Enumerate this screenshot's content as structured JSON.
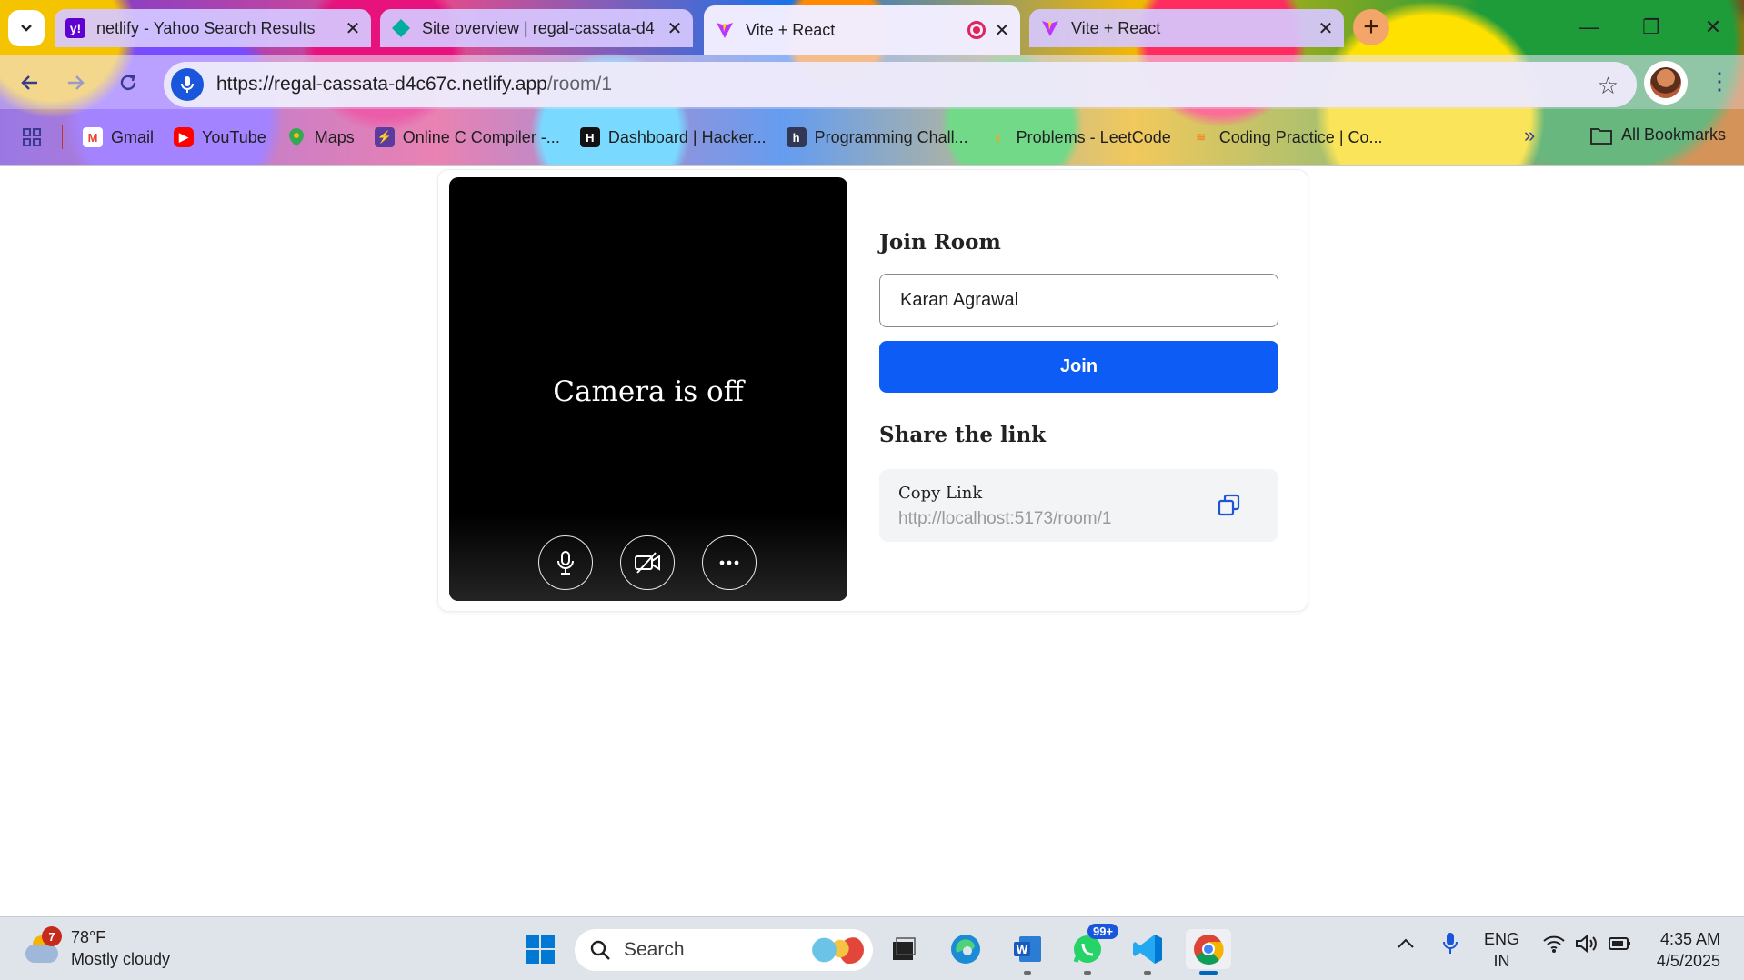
{
  "browser": {
    "tabs": [
      {
        "title": "netlify - Yahoo Search Results",
        "favicon": "yahoo-icon",
        "color": "#6001d2"
      },
      {
        "title": "Site overview | regal-cassata-d4",
        "favicon": "netlify-icon",
        "color": "#00ad9f"
      },
      {
        "title": "Vite + React",
        "favicon": "vite-icon",
        "color": "#bd34fe",
        "active": true,
        "recording": true
      },
      {
        "title": "Vite + React",
        "favicon": "vite-icon",
        "color": "#bd34fe"
      }
    ],
    "url_host": "https://regal-cassata-d4c67c.netlify.app",
    "url_path": "/room/1",
    "bookmarks": [
      {
        "label": "Gmail",
        "icon": "gmail-icon",
        "color": "#ea4335"
      },
      {
        "label": "YouTube",
        "icon": "youtube-icon",
        "color": "#ff0000"
      },
      {
        "label": "Maps",
        "icon": "maps-icon",
        "color": "#34a853"
      },
      {
        "label": "Online C Compiler -...",
        "icon": "compiler-icon",
        "color": "#5b3c9e"
      },
      {
        "label": "Dashboard | Hacker...",
        "icon": "hackerrank-icon",
        "color": "#111111"
      },
      {
        "label": "Programming Chall...",
        "icon": "hackerearth-icon",
        "color": "#323754"
      },
      {
        "label": "Problems - LeetCode",
        "icon": "leetcode-icon",
        "color": "#ffa116"
      },
      {
        "label": "Coding Practice | Co...",
        "icon": "codingninjas-icon",
        "color": "#f08a24"
      }
    ],
    "all_bookmarks": "All Bookmarks"
  },
  "room": {
    "camera_status": "Camera is off",
    "join_heading": "Join Room",
    "name_value": "Karan Agrawal",
    "join_label": "Join",
    "share_heading": "Share the link",
    "copy_label": "Copy Link",
    "share_url": "http://localhost:5173/room/1",
    "accent": "#0d5cf5"
  },
  "taskbar": {
    "weather_temp": "78°F",
    "weather_desc": "Mostly cloudy",
    "weather_badge": "7",
    "search_label": "Search",
    "whatsapp_badge": "99+",
    "lang_line1": "ENG",
    "lang_line2": "IN",
    "time": "4:35 AM",
    "date": "4/5/2025"
  }
}
